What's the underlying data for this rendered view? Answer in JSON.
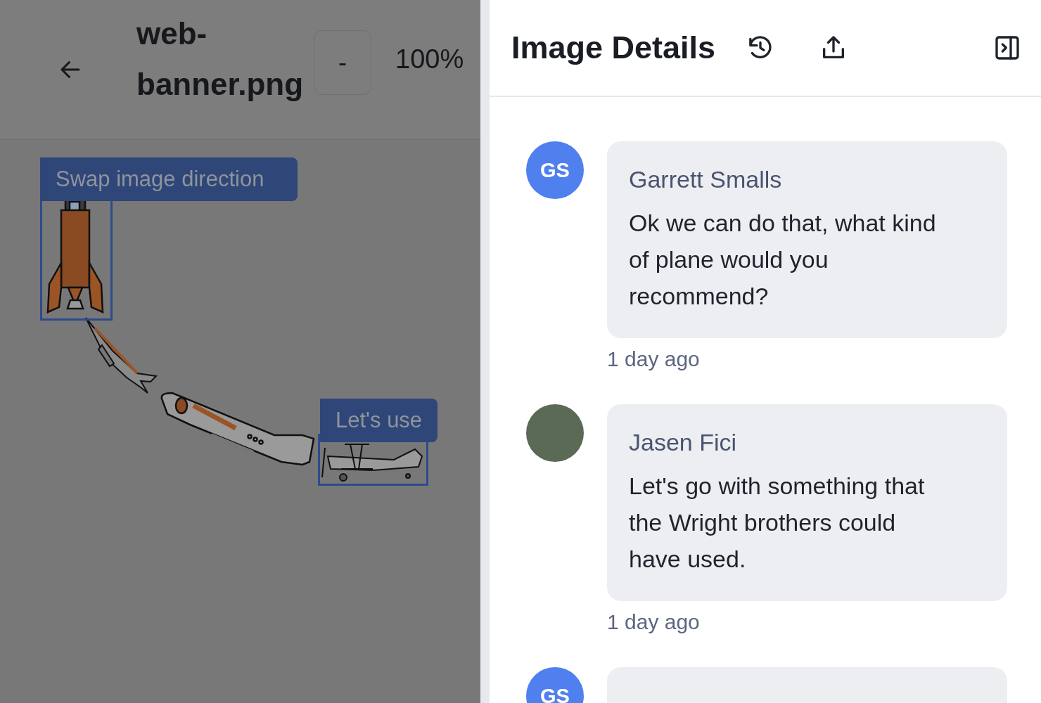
{
  "file": {
    "name": "web-banner.png",
    "zoom_out": "-",
    "zoom": "100%"
  },
  "canvas": {
    "annotations": [
      {
        "label": "Swap image direction"
      },
      {
        "label": "Let's use"
      }
    ]
  },
  "details": {
    "title": "Image Details"
  },
  "comments": [
    {
      "kind": "initials",
      "initials": "GS",
      "author": "Garrett Smalls",
      "text": "Ok we can do that, what kind of plane would you recommend?",
      "time": "1 day ago"
    },
    {
      "kind": "photo",
      "author": "Jasen Fici",
      "text": "Let's go with something that the Wright brothers could have used.",
      "time": "1 day ago"
    },
    {
      "kind": "initials",
      "initials": "GS"
    }
  ]
}
